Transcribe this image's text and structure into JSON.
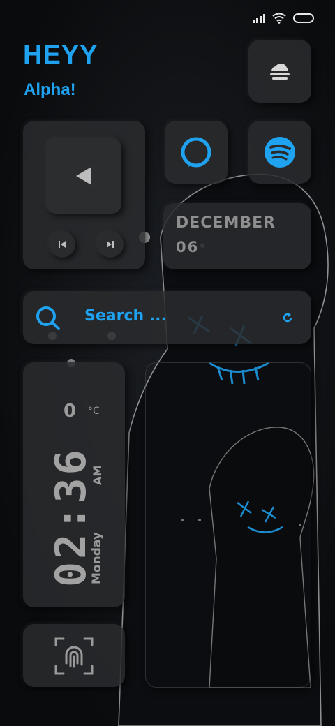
{
  "status_bar": {
    "icons": [
      "signal-icon",
      "wifi-icon",
      "battery-icon"
    ]
  },
  "greeting": {
    "line1": "HEYY",
    "line2": "Alpha!"
  },
  "weather": {
    "icon": "cloud-fog-icon"
  },
  "apps": [
    {
      "name": "Alexa",
      "icon": "alexa-icon"
    },
    {
      "name": "Spotify",
      "icon": "spotify-icon"
    }
  ],
  "music": {
    "icons": [
      "play-icon",
      "previous-icon",
      "next-icon"
    ]
  },
  "date": {
    "month": "DECEMBER",
    "day": "06"
  },
  "search": {
    "placeholder": "Search ...",
    "icons": [
      "search-icon",
      "refresh-icon"
    ]
  },
  "clock": {
    "temperature": "0",
    "temp_unit": "°C",
    "time": "02:36",
    "ampm": "AM",
    "day": "Monday"
  },
  "fingerprint": {
    "icon": "fingerprint-icon"
  },
  "colors": {
    "accent": "#1fa2f0",
    "card": "#2a2b2d",
    "background": "#0b0c0e",
    "text": "#8e8e8e"
  }
}
